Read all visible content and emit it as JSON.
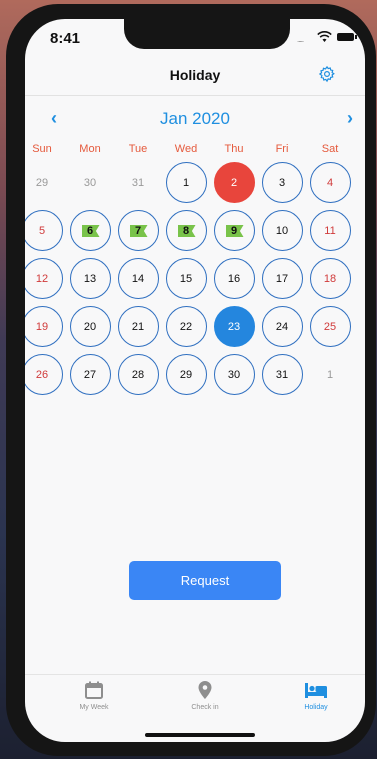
{
  "status": {
    "time": "8:41",
    "signal_dots": "....."
  },
  "nav": {
    "title": "Holiday",
    "settings_icon": "gear-icon"
  },
  "calendar": {
    "month_label": "Jan 2020",
    "prev_icon": "chevron-left-icon",
    "next_icon": "chevron-right-icon",
    "weekdays": [
      "Sun",
      "Mon",
      "Tue",
      "Wed",
      "Thu",
      "Fri",
      "Sat"
    ],
    "weeks": [
      [
        {
          "d": "29",
          "k": "outside"
        },
        {
          "d": "30",
          "k": "outside"
        },
        {
          "d": "31",
          "k": "outside"
        },
        {
          "d": "1",
          "k": ""
        },
        {
          "d": "2",
          "k": "holiday"
        },
        {
          "d": "3",
          "k": ""
        },
        {
          "d": "4",
          "k": "weekend"
        }
      ],
      [
        {
          "d": "5",
          "k": "weekend"
        },
        {
          "d": "6",
          "k": "flag"
        },
        {
          "d": "7",
          "k": "flag"
        },
        {
          "d": "8",
          "k": "flag"
        },
        {
          "d": "9",
          "k": "flag"
        },
        {
          "d": "10",
          "k": ""
        },
        {
          "d": "11",
          "k": "weekend"
        }
      ],
      [
        {
          "d": "12",
          "k": "weekend"
        },
        {
          "d": "13",
          "k": ""
        },
        {
          "d": "14",
          "k": ""
        },
        {
          "d": "15",
          "k": ""
        },
        {
          "d": "16",
          "k": ""
        },
        {
          "d": "17",
          "k": ""
        },
        {
          "d": "18",
          "k": "weekend"
        }
      ],
      [
        {
          "d": "19",
          "k": "weekend"
        },
        {
          "d": "20",
          "k": ""
        },
        {
          "d": "21",
          "k": ""
        },
        {
          "d": "22",
          "k": ""
        },
        {
          "d": "23",
          "k": "selected"
        },
        {
          "d": "24",
          "k": ""
        },
        {
          "d": "25",
          "k": "weekend"
        }
      ],
      [
        {
          "d": "26",
          "k": "weekend"
        },
        {
          "d": "27",
          "k": ""
        },
        {
          "d": "28",
          "k": ""
        },
        {
          "d": "29",
          "k": ""
        },
        {
          "d": "30",
          "k": ""
        },
        {
          "d": "31",
          "k": ""
        },
        {
          "d": "1",
          "k": "outside"
        }
      ]
    ],
    "colors": {
      "accent": "#1f8fe0",
      "holiday": "#e8453c",
      "selected": "#2486de",
      "flag": "#79c34a",
      "weekend": "#d03a3a"
    }
  },
  "actions": {
    "request_label": "Request"
  },
  "tabbar": {
    "tabs": [
      {
        "label": "My Week",
        "icon": "calendar-icon",
        "active": false
      },
      {
        "label": "Check in",
        "icon": "location-pin-icon",
        "active": false
      },
      {
        "label": "Holiday",
        "icon": "bed-icon",
        "active": true
      }
    ]
  }
}
